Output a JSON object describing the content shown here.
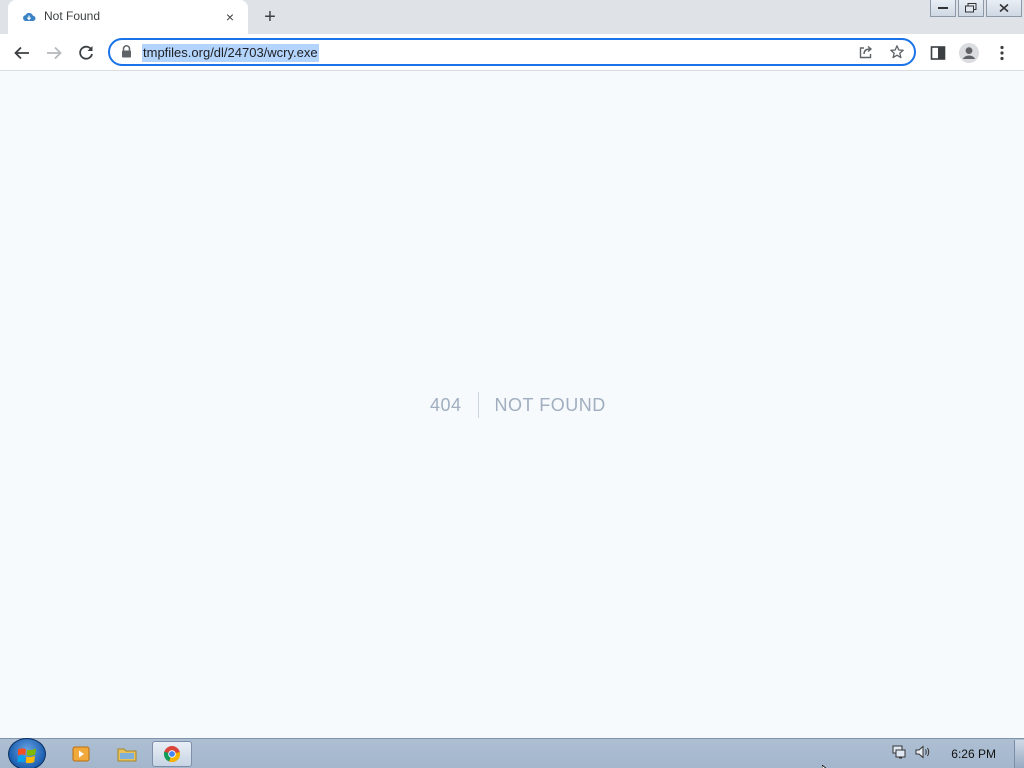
{
  "browser": {
    "tab": {
      "title": "Not Found",
      "close_glyph": "×"
    },
    "new_tab_glyph": "+",
    "address": {
      "url": "tmpfiles.org/dl/24703/wcry.exe"
    },
    "accent_color": "#1a73e8"
  },
  "page": {
    "error_code": "404",
    "error_message": "NOT FOUND",
    "text_color": "#a0aec0",
    "background": "#f7fafc"
  },
  "taskbar": {
    "clock": "6:26 PM",
    "apps": [
      "media-player-icon",
      "file-explorer-icon",
      "chrome-icon"
    ],
    "active_app": "chrome-icon"
  },
  "icons": {
    "tab_favicon": "cloud-icon",
    "back": "back-arrow-icon",
    "forward": "forward-arrow-icon",
    "reload": "reload-icon",
    "lock": "lock-icon",
    "share": "share-icon",
    "bookmark": "star-icon",
    "side_panel": "side-panel-icon",
    "profile": "profile-icon",
    "menu": "kebab-menu-icon"
  }
}
